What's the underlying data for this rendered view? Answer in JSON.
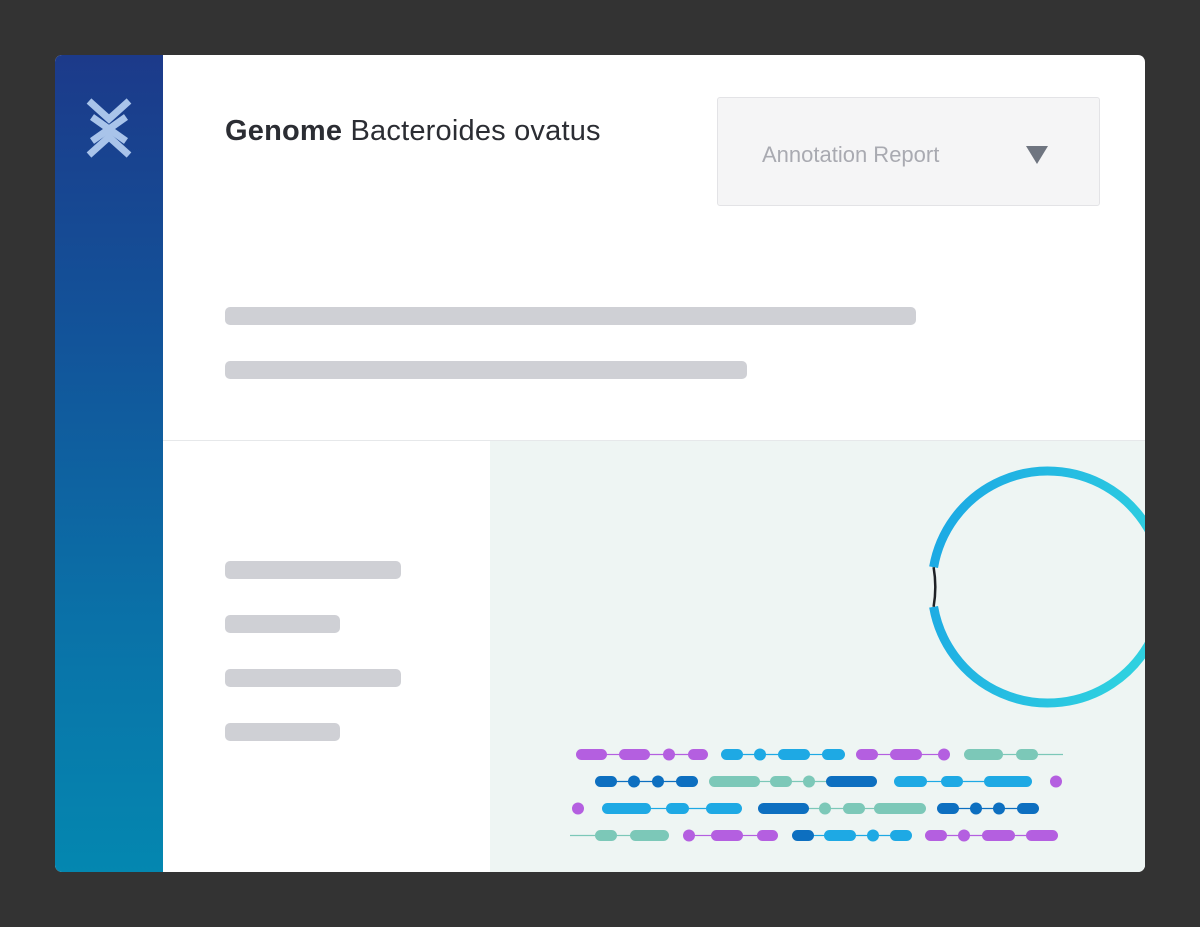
{
  "header": {
    "title_bold": "Genome",
    "title_rest": "Bacteroides ovatus"
  },
  "report_selector": {
    "selected": "Annotation Report",
    "arrow_icon": "triangle-down-icon"
  },
  "sidebar": {
    "logo_icon": "x-helix-logo-icon"
  },
  "colors": {
    "sidebar_top": "#1c3a8a",
    "sidebar_bottom": "#0487b0",
    "ring_start": "#1aa6e4",
    "ring_end": "#2fd0e0",
    "purple": "#b45fe0",
    "blue_dark": "#0d6fc0",
    "blue_light": "#1ea9e4",
    "teal": "#7cc8b8",
    "placeholder": "#cfd0d5",
    "viz_background": "#eef5f3"
  }
}
